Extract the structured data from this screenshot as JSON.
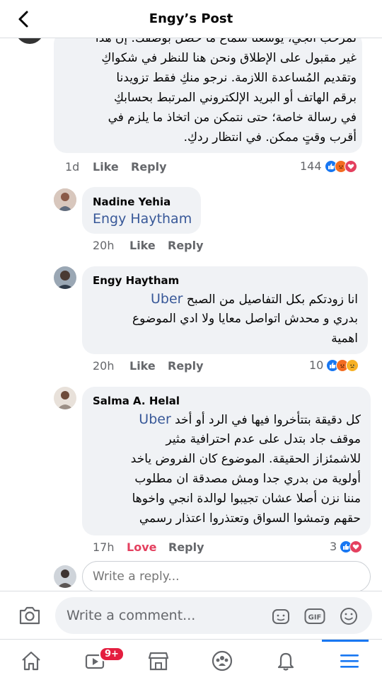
{
  "header": {
    "title": "Engy’s Post"
  },
  "comments": [
    {
      "text_lines": [
        "لمرحب انجي، يوسعنا سماع ما حصل بوصفك. إن هذا",
        "غير مقبول على الإطلاق ونحن هنا للنظر في شكواكِ",
        "وتقديم المُساعدة اللازمة. نرجو منكِ فقط تزويدنا",
        "برقم الهاتف أو البريد الإلكتروني المرتبط بحسابكِ",
        "في رسالة خاصة؛ حتى نتمكن من اتخاذ ما يلزم في",
        "أقرب وقتٍ ممكن. في انتظار ردكِ."
      ],
      "time": "1d",
      "like": "Like",
      "reply": "Reply",
      "reaction_count": "144",
      "reaction_icons": [
        "like",
        "angry",
        "love"
      ]
    },
    {
      "name": "Nadine Yehia",
      "mention": "Engy Haytham",
      "time": "20h",
      "like": "Like",
      "reply": "Reply"
    },
    {
      "name": "Engy Haytham",
      "mention": "Uber",
      "line1": "انا زودتكم بكل التفاصيل من الصبح",
      "line2": "بدري و محدش اتواصل معايا ولا ادي الموضوع",
      "line3": "اهمية",
      "time": "20h",
      "like": "Like",
      "reply": "Reply",
      "reaction_count": "10",
      "reaction_icons": [
        "like",
        "angry",
        "sad"
      ]
    },
    {
      "name": "Salma A. Helal",
      "mention": "Uber",
      "line1": "كل دقيقة بتتأخروا فيها في الرد أو أخد",
      "line2": "موقف جاد بتدل على عدم احترافية مثير",
      "line3": "للاشمئزاز الحقيقة. الموضوع كان الفروض ياخد",
      "line4": "أولوية من بدري جدا ومش مصدقة ان مطلوب",
      "line5": "مننا نزن أصلا عشان تجيبوا لوالدة انجي واخوها",
      "line6": "حقهم وتمشوا السواق وتعتذروا اعتذار رسمي",
      "time": "17h",
      "like": "Love",
      "reply": "Reply",
      "reaction_count": "3",
      "reaction_icons": [
        "like",
        "love"
      ]
    }
  ],
  "reply_input": {
    "placeholder": "Write a reply..."
  },
  "composer": {
    "placeholder": "Write a comment..."
  },
  "nav": {
    "video_badge": "9+"
  },
  "colors": {
    "accent": "#1877f2",
    "link": "#385898",
    "love": "#e4405f",
    "bubble": "#f0f2f5"
  }
}
